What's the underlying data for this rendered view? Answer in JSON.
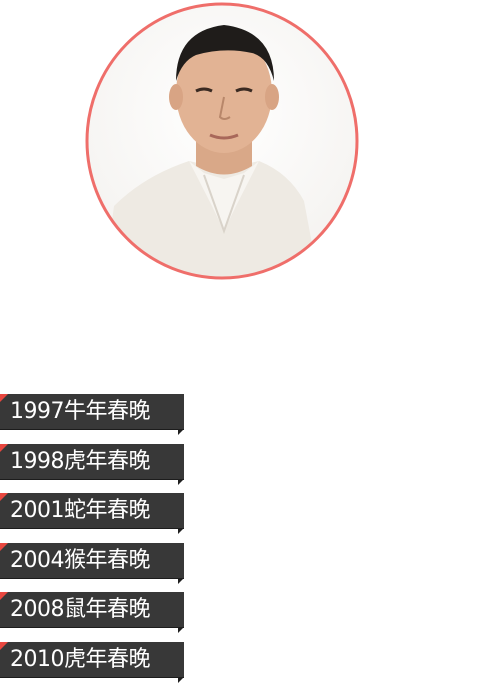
{
  "portrait": {
    "ring_color": "#ef6e6a"
  },
  "tags": [
    {
      "label": "1997牛年春晚"
    },
    {
      "label": "1998虎年春晚"
    },
    {
      "label": "2001蛇年春晚"
    },
    {
      "label": "2004猴年春晚"
    },
    {
      "label": "2008鼠年春晚"
    },
    {
      "label": "2010虎年春晚"
    }
  ],
  "colors": {
    "tag_background": "#383838",
    "tag_accent": "#e8473f",
    "tag_text": "#ffffff"
  }
}
